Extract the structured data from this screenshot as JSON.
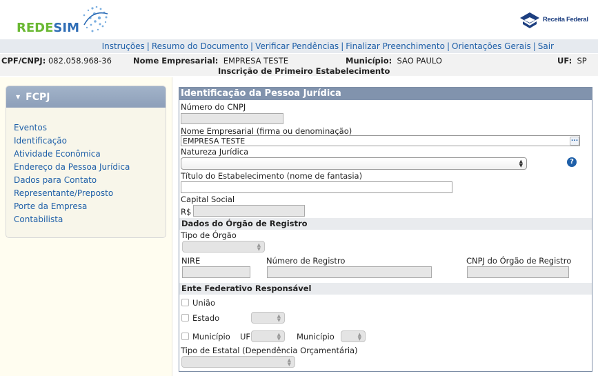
{
  "header": {
    "logo_text": "REDESIM",
    "receita_text": "Receita Federal"
  },
  "nav": [
    {
      "label": "Instruções"
    },
    {
      "label": "Resumo do Documento"
    },
    {
      "label": "Verificar Pendências"
    },
    {
      "label": "Finalizar Preenchimento"
    },
    {
      "label": "Orientações Gerais"
    },
    {
      "label": "Sair"
    }
  ],
  "info": {
    "cpf_label": "CPF/CNPJ:",
    "cpf_value": "082.058.968-36",
    "nome_label": "Nome Empresarial:",
    "nome_value": "EMPRESA TESTE",
    "municipio_label": "Município:",
    "municipio_value": "SAO PAULO",
    "uf_label": "UF:",
    "uf_value": "SP",
    "subtitle": "Inscrição de Primeiro Estabelecimento"
  },
  "sidebar": {
    "title": "FCPJ",
    "items": [
      {
        "label": "Eventos"
      },
      {
        "label": "Identificação"
      },
      {
        "label": "Atividade Econômica"
      },
      {
        "label": "Endereço da Pessoa Jurídica"
      },
      {
        "label": "Dados para Contato"
      },
      {
        "label": "Representante/Preposto"
      },
      {
        "label": "Porte da Empresa"
      },
      {
        "label": "Contabilista"
      }
    ]
  },
  "form": {
    "title": "Identificação da Pessoa Jurídica",
    "cnpj_label": "Número do CNPJ",
    "cnpj_value": "",
    "nome_label": "Nome Empresarial (firma ou denominação)",
    "nome_value": "EMPRESA TESTE",
    "natureza_label": "Natureza Jurídica",
    "natureza_value": "",
    "titulo_label": "Título do Estabelecimento (nome de fantasia)",
    "titulo_value": "",
    "capital_label": "Capital Social",
    "capital_prefix": "R$",
    "capital_value": "",
    "orgao_section": "Dados do Órgão de Registro",
    "tipo_orgao_label": "Tipo de Órgão",
    "nire_label": "NIRE",
    "num_registro_label": "Número de Registro",
    "cnpj_orgao_label": "CNPJ do Órgão de Registro",
    "ente_section": "Ente Federativo Responsável",
    "uniao_label": "União",
    "estado_label": "Estado",
    "municipio_label": "Município",
    "uf_label": "UF",
    "municipio2_label": "Município",
    "tipo_estatal_label": "Tipo de Estatal (Dependência Orçamentária)"
  },
  "colors": {
    "link": "#1e5fa8",
    "form_title_bg": "#8193ad",
    "sidebar_head_bg": "#95a7bf",
    "logo_green": "#6ab833",
    "logo_blue": "#2f6db5"
  },
  "icons": [
    "globe-swirl-icon",
    "receita-emblem-icon",
    "caret-down-icon",
    "ellipsis-icon",
    "help-icon",
    "select-arrows-icon"
  ]
}
